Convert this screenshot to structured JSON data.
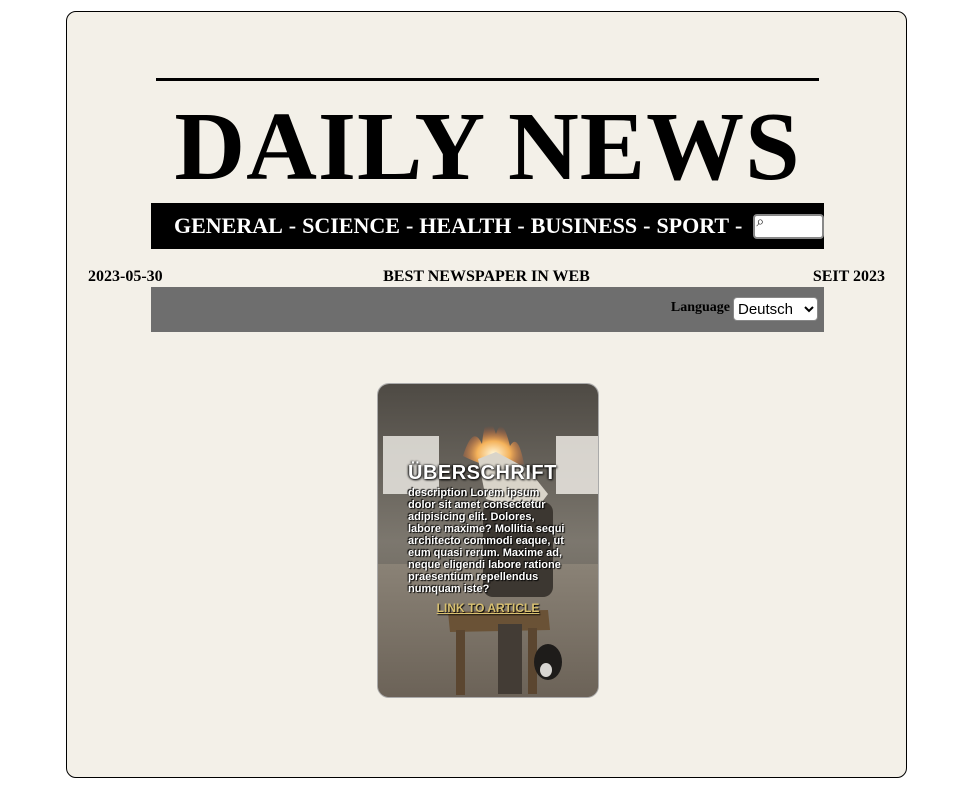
{
  "header": {
    "masthead": "DAILY NEWS"
  },
  "nav": {
    "items": [
      "GENERAL",
      "SCIENCE",
      "HEALTH",
      "BUSINESS",
      "SPORT"
    ],
    "separator": "-",
    "search_placeholder": "",
    "search_icon": "search-icon"
  },
  "infoline": {
    "date": "2023-05-30",
    "slogan": "BEST NEWSPAPER IN WEB",
    "since": "SEIT 2023"
  },
  "language": {
    "label": "Language",
    "selected": "Deutsch"
  },
  "article": {
    "heading": "ÜBERSCHRIFT",
    "description": "description Lorem ipsum dolor sit amet consectetur adipisicing elit. Dolores, labore maxime? Mollitia sequi architecto commodi eaque, ut eum quasi rerum. Maxime ad, neque eligendi labore ratione praesentium repellendus numquam iste?",
    "link": "LINK TO ARTICLE"
  }
}
